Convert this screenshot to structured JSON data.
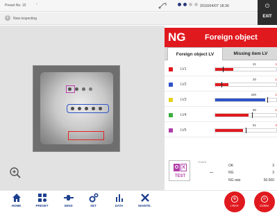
{
  "topbar": {
    "preset_label": "Preset No. 15",
    "datetime": "2016/04/07 18:36",
    "exit_label": "EXIT",
    "status_dots": [
      true,
      true,
      false,
      false
    ]
  },
  "status": {
    "text": "Now inspecting"
  },
  "result": {
    "code": "NG",
    "label": "Foreign object",
    "color": "#e0191f"
  },
  "tabs": [
    {
      "label": "Foreign object LV",
      "active": true
    },
    {
      "label": "Missing item LV",
      "active": false
    }
  ],
  "levels": [
    {
      "name": "LV1",
      "color": "#e0191f",
      "value": "21",
      "max": "1",
      "fill_pct": 30,
      "fill_color": "#e0191f"
    },
    {
      "name": "LV2",
      "color": "#2e52c8",
      "value": "20",
      "max": "1",
      "fill_pct": 22,
      "fill_color": "#e0191f"
    },
    {
      "name": "LV3",
      "color": "#e6d21a",
      "value": "200",
      "max": "1",
      "fill_pct": 82,
      "fill_color": "#2e52c8"
    },
    {
      "name": "LV4",
      "color": "#3cae3c",
      "value": "60",
      "max": "1",
      "fill_pct": 55,
      "fill_color": "#e0191f"
    },
    {
      "name": "LV5",
      "color": "#b13ea8",
      "value": "51",
      "max": "2",
      "fill_pct": 45,
      "fill_color": "#e0191f"
    }
  ],
  "test": {
    "label": "TEST",
    "ok_glyph": "O",
    "ng_glyph": "X"
  },
  "counts": {
    "label": "Count",
    "rows": [
      {
        "name": "OK",
        "value": "3"
      },
      {
        "name": "NG",
        "value": "3"
      },
      {
        "name": "NG rate",
        "value": "50.000"
      }
    ]
  },
  "nav": [
    {
      "label": "HOME",
      "icon": "home-icon"
    },
    {
      "label": "PRESET",
      "icon": "preset-icon"
    },
    {
      "label": "SENS",
      "icon": "sensitivity-icon"
    },
    {
      "label": "SET",
      "icon": "settings-icon"
    },
    {
      "label": "DATA",
      "icon": "chart-icon"
    },
    {
      "label": "MAINTE.",
      "icon": "maintenance-icon"
    }
  ],
  "round_buttons": [
    {
      "label": "I-RAY",
      "icon": "ray-icon"
    },
    {
      "label": "CONV.",
      "icon": "conveyor-icon"
    }
  ]
}
